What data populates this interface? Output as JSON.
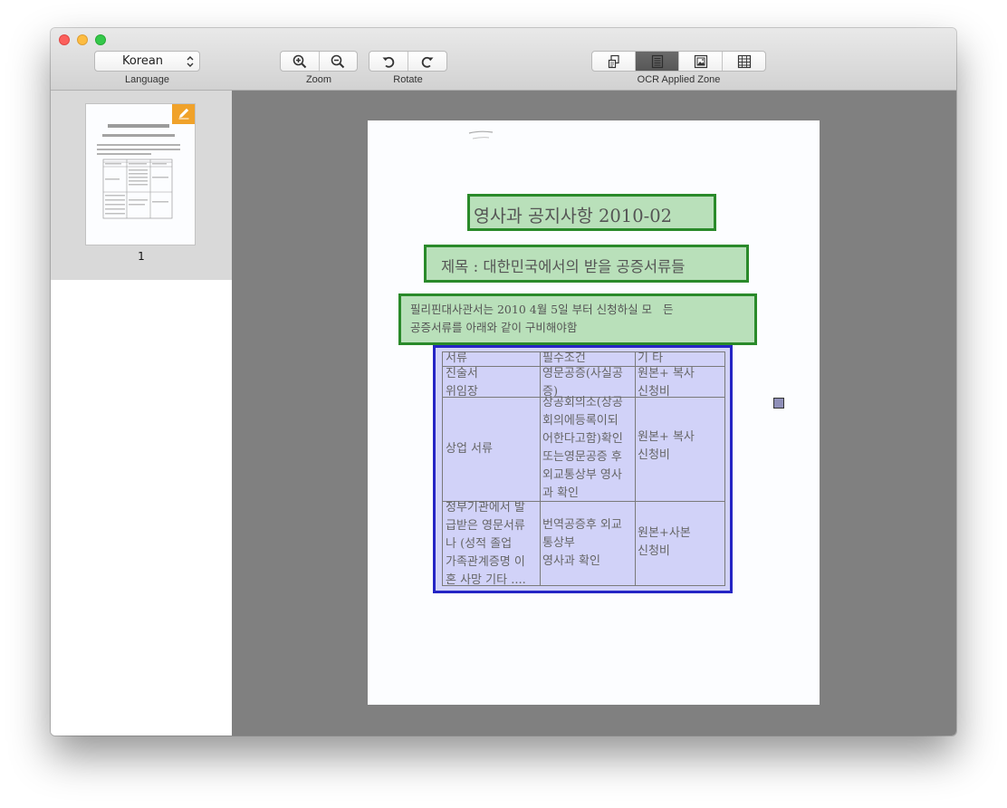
{
  "toolbar": {
    "language": {
      "label": "Language",
      "value": "Korean"
    },
    "zoom": {
      "label": "Zoom",
      "buttons": [
        "zoom-in-icon",
        "zoom-out-icon"
      ]
    },
    "rotate": {
      "label": "Rotate",
      "buttons": [
        "rotate-left-icon",
        "rotate-right-icon"
      ]
    },
    "ocr_zone": {
      "label": "OCR Applied Zone",
      "buttons": [
        "mixed-zone-icon",
        "text-zone-icon",
        "image-zone-icon",
        "table-zone-icon"
      ],
      "active_index": 1
    }
  },
  "sidebar": {
    "pages": [
      {
        "number": "1",
        "badge_icon": "pencil-icon",
        "selected": true
      }
    ]
  },
  "document": {
    "title": "영사과 공지사항 2010-02",
    "subject": "제목 : 대한민국에서의 받을 공증서류들",
    "intro_line1": "필리핀대사관서는 2010 4월 5일 부터 신청하실 모   든",
    "intro_line2": "공증서류를 아래와 같이 구비해야함",
    "table": {
      "headers": [
        "서류",
        "필수조건",
        "기 타"
      ],
      "rows": [
        [
          "진술서\n위임장",
          "영문공증(사실공\n증)",
          "원본+ 복사\n신청비"
        ],
        [
          "상업 서류",
          "상공회의소(상공\n회의에등록이되\n어한다고함)확인\n또는영문공증 후\n외교통상부 영사\n과 확인",
          "원본+ 복사\n신청비"
        ],
        [
          "정부기관에서 발\n급받은 영문서류\n나 (성적 졸업\n가족관계증명 이\n혼 사망 기타 ....",
          "번역공증후 외교\n통상부\n영사과 확인",
          "원본+사본\n신청비"
        ]
      ]
    }
  },
  "zones": {
    "text_color": "#2a8a2a",
    "table_color": "#2525c5"
  }
}
